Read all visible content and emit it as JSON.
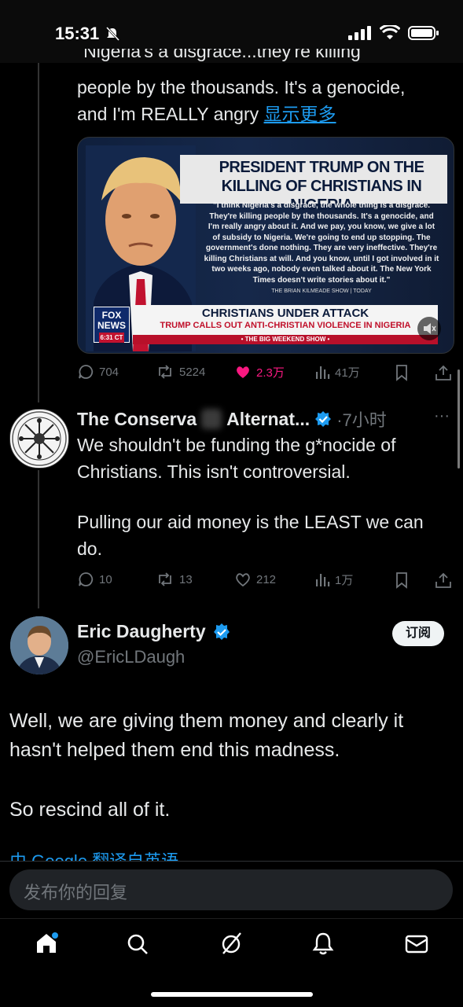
{
  "status": {
    "time": "15:31"
  },
  "quoted_tweet": {
    "text_cut": "\"Nigeria's a disgrace...they're killing",
    "text_line2": "people by the thousands. It's a genocide,",
    "text_line3": "and I'm REALLY angry",
    "show_more": "显示更多",
    "media": {
      "headline": "PRESIDENT TRUMP ON THE KILLING OF CHRISTIANS IN NIGERIA",
      "quote": "\"I think Nigeria's a disgrace, the whole thing is a disgrace. They're killing people by the thousands. It's a genocide, and I'm really angry about it. And we pay, you know, we give a lot of subsidy to Nigeria. We're going to end up stopping. The government's done nothing. They are very ineffective. They're killing Christians at will. And you know, until I got involved in it two weeks ago, nobody even talked about it. The New York Times doesn't write stories about it.\"",
      "source": "THE BRIAN KILMEADE SHOW | TODAY",
      "banner_title": "CHRISTIANS UNDER ATTACK",
      "banner_sub": "TRUMP CALLS OUT ANTI-CHRISTIAN VIOLENCE IN NIGERIA",
      "banner_show": "• THE BIG WEEKEND SHOW •",
      "logo_text": "FOX NEWS",
      "logo_time": "6:31 CT"
    },
    "actions": {
      "replies": "704",
      "reposts": "5224",
      "likes": "2.3万",
      "views": "41万"
    }
  },
  "reply_tweet": {
    "name_part1": "The Conserva",
    "name_part2": "Alternat...",
    "time": "·7小时",
    "more": "···",
    "text1": "We shouldn't be funding the g*nocide of Christians. This isn't controversial.",
    "text2": "Pulling our aid money is the LEAST we can do.",
    "actions": {
      "replies": "10",
      "reposts": "13",
      "likes": "212",
      "views": "1万"
    }
  },
  "main_tweet": {
    "name": "Eric Daugherty",
    "handle": "@EricLDaugh",
    "subscribe": "订阅",
    "text1": "Well, we are giving them money and clearly it hasn't helped them end this madness.",
    "text2": "So rescind all of it.",
    "translate_cut": "由 Google 翻译自英语"
  },
  "reply_box": {
    "placeholder": "发布你的回复"
  },
  "tabs": [
    "home-icon",
    "search-icon",
    "grok-icon",
    "notifications-icon",
    "messages-icon"
  ],
  "colors": {
    "accent": "#1d9bf0",
    "like": "#f91880",
    "verified": "#1d9bf0"
  }
}
